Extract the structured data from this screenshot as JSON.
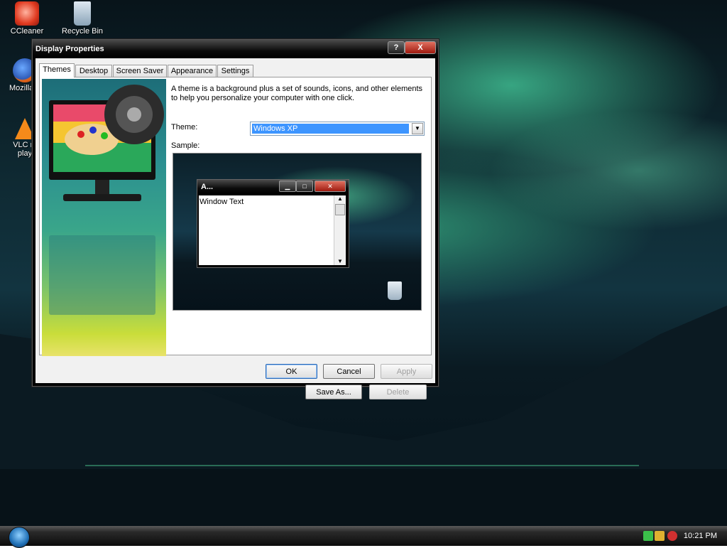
{
  "desktop": {
    "icons": [
      {
        "label": "CCleaner"
      },
      {
        "label": "Recycle Bin"
      },
      {
        "label": "Mozilla F"
      },
      {
        "label": "VLC m"
      },
      {
        "label": "play"
      }
    ]
  },
  "dialog": {
    "title": "Display Properties",
    "help_label": "?",
    "close_label": "X",
    "tabs": [
      {
        "label": "Themes",
        "active": true
      },
      {
        "label": "Desktop"
      },
      {
        "label": "Screen Saver"
      },
      {
        "label": "Appearance"
      },
      {
        "label": "Settings"
      }
    ],
    "description": "A theme is a background plus a set of sounds, icons, and other elements to help you personalize your computer with one click.",
    "theme_label": "Theme:",
    "theme_value": "Windows XP",
    "sample_label": "Sample:",
    "sample_window": {
      "title": "A...",
      "text": "Window Text"
    },
    "save_as_label": "Save As...",
    "delete_label": "Delete",
    "ok_label": "OK",
    "cancel_label": "Cancel",
    "apply_label": "Apply"
  },
  "taskbar": {
    "time": "10:21 PM"
  }
}
